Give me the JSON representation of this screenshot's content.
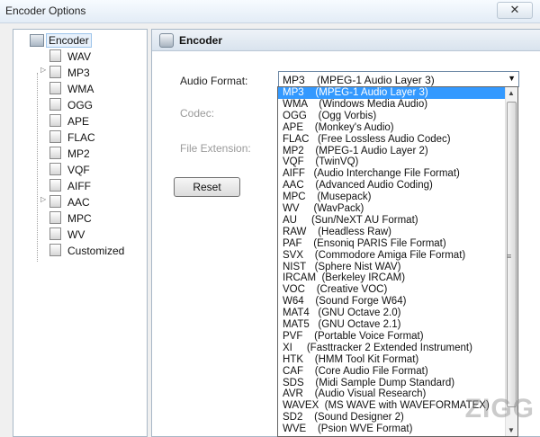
{
  "window": {
    "title": "Encoder Options",
    "close_label": "✕"
  },
  "tree": {
    "root": "Encoder",
    "items": [
      {
        "label": "WAV"
      },
      {
        "label": "MP3"
      },
      {
        "label": "WMA"
      },
      {
        "label": "OGG"
      },
      {
        "label": "APE"
      },
      {
        "label": "FLAC"
      },
      {
        "label": "MP2"
      },
      {
        "label": "VQF"
      },
      {
        "label": "AIFF"
      },
      {
        "label": "AAC"
      },
      {
        "label": "MPC"
      },
      {
        "label": "WV"
      },
      {
        "label": "Customized"
      }
    ]
  },
  "panel": {
    "title": "Encoder",
    "audio_format_label": "Audio Format:",
    "codec_label": "Codec:",
    "file_extension_label": "File Extension:",
    "selected_format": "MP3    (MPEG-1 Audio Layer 3)",
    "reset_label": "Reset"
  },
  "dropdown": {
    "options": [
      "MP3    (MPEG-1 Audio Layer 3)",
      "WMA    (Windows Media Audio)",
      "OGG    (Ogg Vorbis)",
      "APE    (Monkey's Audio)",
      "FLAC   (Free Lossless Audio Codec)",
      "MP2    (MPEG-1 Audio Layer 2)",
      "VQF    (TwinVQ)",
      "AIFF   (Audio Interchange File Format)",
      "AAC    (Advanced Audio Coding)",
      "MPC    (Musepack)",
      "WV     (WavPack)",
      "AU     (Sun/NeXT AU Format)",
      "RAW    (Headless Raw)",
      "PAF    (Ensoniq PARIS File Format)",
      "SVX    (Commodore Amiga File Format)",
      "NIST   (Sphere Nist WAV)",
      "IRCAM  (Berkeley IRCAM)",
      "VOC    (Creative VOC)",
      "W64    (Sound Forge W64)",
      "MAT4   (GNU Octave 2.0)",
      "MAT5   (GNU Octave 2.1)",
      "PVF    (Portable Voice Format)",
      "XI     (Fasttracker 2 Extended Instrument)",
      "HTK    (HMM Tool Kit Format)",
      "CAF    (Core Audio File Format)",
      "SDS    (Midi Sample Dump Standard)",
      "AVR    (Audio Visual Research)",
      "WAVEX  (MS WAVE with WAVEFORMATEX)",
      "SD2    (Sound Designer 2)",
      "WVE    (Psion WVE Format)"
    ],
    "selected_index": 0
  },
  "watermark": "ZIGG",
  "colors": {
    "selection": "#3399ff",
    "border": "#a9b8c7"
  }
}
